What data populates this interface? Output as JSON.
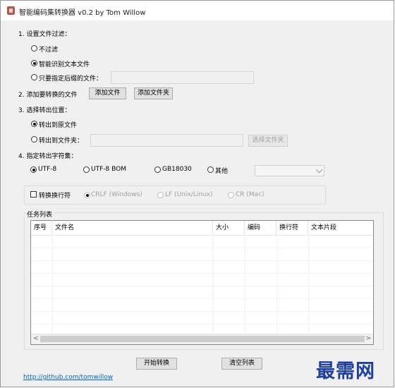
{
  "window": {
    "title": "智能编码集转换器 v0.2 by Tom Willow"
  },
  "filter": {
    "heading": "1. 设置文件过滤：",
    "options": [
      "不过滤",
      "智能识别文本文件",
      "只要指定后缀的文件："
    ],
    "selected": 1,
    "suffix_value": ""
  },
  "add": {
    "heading": "2. 添加要转换的文件",
    "add_file": "添加文件",
    "add_folder": "添加文件夹"
  },
  "output": {
    "heading": "3. 选择转出位置：",
    "options": [
      "转出到原文件",
      "转出到文件夹："
    ],
    "selected": 0,
    "folder_value": "",
    "choose_folder": "选择文件夹"
  },
  "charset": {
    "heading": "4. 指定转出字符集：",
    "options": [
      "UTF-8",
      "UTF-8 BOM",
      "GB18030",
      "其他"
    ],
    "selected": 0,
    "other_value": ""
  },
  "newline": {
    "checkbox_label": "转换换行符",
    "checked": false,
    "options": [
      "CRLF (Windows)",
      "LF (Unix/Linux)",
      "CR (Mac)"
    ]
  },
  "tasks": {
    "label": "任务列表",
    "columns": [
      "序号",
      "文件名",
      "大小",
      "编码",
      "换行符",
      "文本片段"
    ],
    "rows": []
  },
  "actions": {
    "start": "开始转换",
    "clear": "清空列表"
  },
  "footer": {
    "link": "http://github.com/tomwillow"
  },
  "watermark": "最需网"
}
